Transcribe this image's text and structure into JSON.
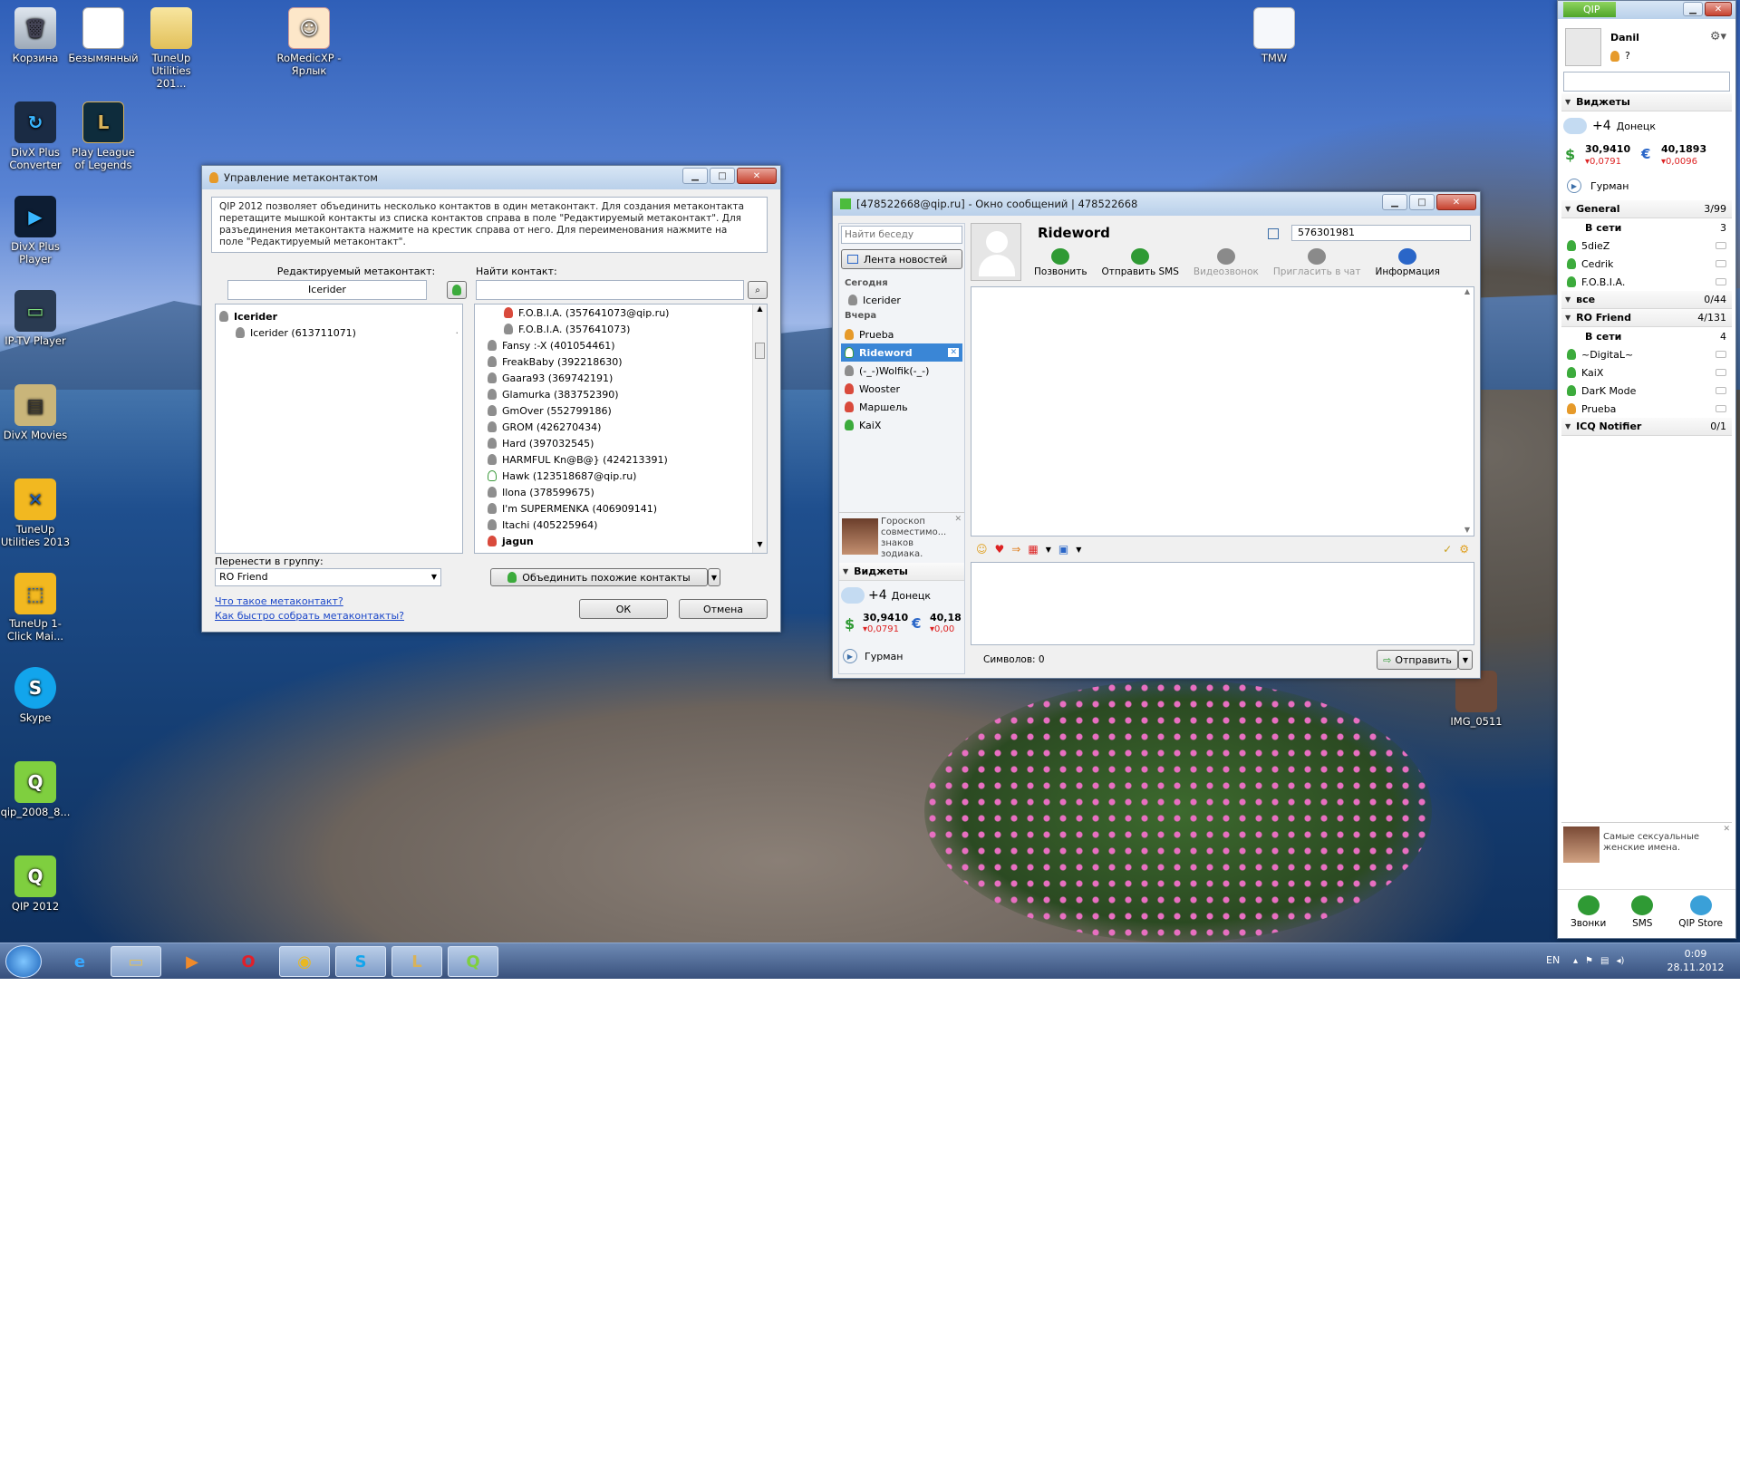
{
  "desktop": {
    "icons": [
      {
        "label": "Корзина",
        "icon": "recycle-bin-icon"
      },
      {
        "label": "Безымянный",
        "icon": "document-icon"
      },
      {
        "label": "TuneUp Utilities 201...",
        "icon": "folder-icon"
      },
      {
        "label": "RoMedicXP - Ярлык",
        "icon": "romedic-icon"
      },
      {
        "label": "TMW",
        "icon": "file-icon"
      },
      {
        "label": "DivX Plus Converter",
        "icon": "divx-converter-icon"
      },
      {
        "label": "Play League of Legends",
        "icon": "lol-icon"
      },
      {
        "label": "DivX Plus Player",
        "icon": "divx-player-icon"
      },
      {
        "label": "IP-TV Player",
        "icon": "iptv-icon"
      },
      {
        "label": "DivX Movies",
        "icon": "divx-movies-icon"
      },
      {
        "label": "TuneUp Utilities 2013",
        "icon": "tuneup-icon"
      },
      {
        "label": "TuneUp 1-Click Mai...",
        "icon": "tuneup-1click-icon"
      },
      {
        "label": "Skype",
        "icon": "skype-icon"
      },
      {
        "label": "qip_2008_8...",
        "icon": "qip-icon"
      },
      {
        "label": "QIP 2012",
        "icon": "qip-icon"
      },
      {
        "label": "IMG_0511",
        "icon": "image-icon"
      }
    ]
  },
  "meta": {
    "title": "Управление метаконтактом",
    "info": "QIP 2012 позволяет объединить несколько контактов в один метаконтакт. Для создания метаконтакта перетащите мышкой контакты из списка контактов справа в поле \"Редактируемый метаконтакт\". Для разъединения метаконтакта нажмите на крестик справа от него. Для переименования нажмите на поле \"Редактируемый метаконтакт\".",
    "edit_label": "Редактируемый метаконтакт:",
    "edit_value": "Icerider",
    "find_label": "Найти контакт:",
    "find_value": "",
    "tree": {
      "parent": "Icerider",
      "child": "Icerider (613711071)"
    },
    "contacts": [
      {
        "name": "F.O.B.I.A. (357641073@qip.ru)",
        "st": "r",
        "ind": 1
      },
      {
        "name": "F.O.B.I.A. (357641073)",
        "st": "",
        "ind": 1
      },
      {
        "name": "Fansy :-X (401054461)",
        "st": "",
        "ind": 0
      },
      {
        "name": "FreakBaby (392218630)",
        "st": "",
        "ind": 0
      },
      {
        "name": "Gaara93 (369742191)",
        "st": "",
        "ind": 0
      },
      {
        "name": "Glamurka (383752390)",
        "st": "",
        "ind": 0
      },
      {
        "name": "GmOver (552799186)",
        "st": "",
        "ind": 0
      },
      {
        "name": "GROM (426270434)",
        "st": "",
        "ind": 0
      },
      {
        "name": "Hard (397032545)",
        "st": "",
        "ind": 0
      },
      {
        "name": "HARMFUL Kn@B@} (424213391)",
        "st": "",
        "ind": 0
      },
      {
        "name": "Hawk (123518687@qip.ru)",
        "st": "w",
        "ind": 0
      },
      {
        "name": "Ilona (378599675)",
        "st": "",
        "ind": 0
      },
      {
        "name": "I'm SUPERMENKA (406909141)",
        "st": "",
        "ind": 0
      },
      {
        "name": "Itachi (405225964)",
        "st": "",
        "ind": 0
      },
      {
        "name": "jagun",
        "st": "r",
        "ind": 0
      }
    ],
    "move_label": "Перенести в группу:",
    "move_value": "RO Friend",
    "merge_label": "Объединить похожие контакты",
    "link1": "Что такое метаконтакт?",
    "link2": "Как быстро собрать метаконтакты?",
    "ok": "ОК",
    "cancel": "Отмена"
  },
  "msg": {
    "title": "[478522668@qip.ru] - Окно сообщений | 478522668",
    "search_placeholder": "Найти беседу",
    "feed": "Лента новостей",
    "today": "Сегодня",
    "yesterday": "Вчера",
    "chats_today": [
      {
        "name": "Icerider",
        "st": ""
      }
    ],
    "chats_yday": [
      {
        "name": "Prueba",
        "st": "o"
      },
      {
        "name": "Rideword",
        "st": "sel"
      },
      {
        "name": "(-_-)Wolfik(-_-)",
        "st": ""
      },
      {
        "name": "Wooster",
        "st": "r"
      },
      {
        "name": "Маршель",
        "st": "r"
      },
      {
        "name": "KaiX",
        "st": "g"
      }
    ],
    "ad": "Гороскоп совместимо... знаков зодиака.",
    "widgets": "Виджеты",
    "weather": {
      "temp": "+4",
      "city": "Донецк"
    },
    "usd": {
      "val": "30,9410",
      "chg": "▾0,0791"
    },
    "eur": {
      "val": "40,18",
      "chg": "▾0,00"
    },
    "radio": "Гурман",
    "contact": "Rideword",
    "uin": "576301981",
    "actions": [
      {
        "label": "Позвонить",
        "icon": "phone-icon",
        "color": "#2f9a34"
      },
      {
        "label": "Отправить SMS",
        "icon": "sms-icon",
        "color": "#2f9a34"
      },
      {
        "label": "Видеозвонок",
        "icon": "video-call-icon",
        "color": "#8a8a8a"
      },
      {
        "label": "Пригласить в чат",
        "icon": "invite-chat-icon",
        "color": "#8a8a8a"
      },
      {
        "label": "Информация",
        "icon": "info-card-icon",
        "color": "#2a66c8"
      }
    ],
    "chars_label": "Символов:",
    "chars": "0",
    "send": "Отправить"
  },
  "qip": {
    "tab": "QIP",
    "user": "Danil",
    "status": "?",
    "widgets": "Виджеты",
    "weather": {
      "temp": "+4",
      "city": "Донецк"
    },
    "usd": {
      "val": "30,9410",
      "chg": "▾0,0791"
    },
    "eur": {
      "val": "40,1893",
      "chg": "▾0,0096"
    },
    "radio": "Гурман",
    "groups": [
      {
        "name": "General",
        "count": "3/99",
        "sub": "В сети",
        "subcount": "3",
        "items": [
          {
            "name": "5dieZ",
            "st": "g"
          },
          {
            "name": "Cedrik",
            "st": "g"
          },
          {
            "name": "F.O.B.I.A.",
            "st": "g"
          }
        ]
      },
      {
        "name": "все",
        "count": "0/44",
        "collapsed": true
      },
      {
        "name": "RO Friend",
        "count": "4/131",
        "sub": "В сети",
        "subcount": "4",
        "items": [
          {
            "name": "~DigitaL~",
            "st": "g"
          },
          {
            "name": "KaiX",
            "st": "g"
          },
          {
            "name": "DarK Mode",
            "st": "g"
          },
          {
            "name": "Prueba",
            "st": "o"
          }
        ]
      },
      {
        "name": "ICQ Notifier",
        "count": "0/1"
      }
    ],
    "ad": "Самые сексуальные женские имена.",
    "bottom": [
      {
        "label": "Звонки",
        "icon": "phone-icon"
      },
      {
        "label": "SMS",
        "icon": "sms-icon"
      },
      {
        "label": "QIP Store",
        "icon": "store-icon"
      }
    ]
  },
  "taskbar": {
    "lang": "EN",
    "time": "0:09",
    "date": "28.11.2012"
  }
}
